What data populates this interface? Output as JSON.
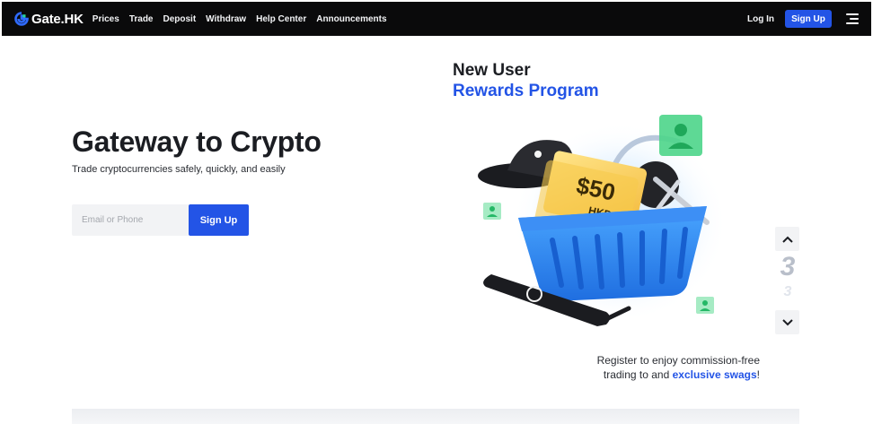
{
  "brand": {
    "name": "Gate.HK"
  },
  "nav": {
    "items": [
      {
        "label": "Prices"
      },
      {
        "label": "Trade"
      },
      {
        "label": "Deposit"
      },
      {
        "label": "Withdraw"
      },
      {
        "label": "Help Center"
      },
      {
        "label": "Announcements"
      }
    ],
    "login": "Log In",
    "signup": "Sign Up",
    "menu_icon": "hamburger-icon"
  },
  "hero": {
    "title": "Gateway to Crypto",
    "subtitle": "Trade cryptocurrencies safely, quickly, and easily",
    "input_placeholder": "Email or Phone",
    "input_value": "",
    "signup": "Sign Up"
  },
  "promo": {
    "line1": "New User",
    "line2": "Rewards Program",
    "voucher_amount": "$50",
    "voucher_currency": "HKD",
    "desc_before": "Register to enjoy commission-free",
    "desc_mid": "trading to and ",
    "desc_accent": "exclusive swags",
    "desc_after": "!"
  },
  "carousel": {
    "current": "3",
    "next": "3",
    "up_icon": "chevron-up-icon",
    "down_icon": "chevron-down-icon"
  },
  "colors": {
    "accent": "#2354e6",
    "nav_bg": "#0a0a0b",
    "user_badge": "#2ecc71"
  }
}
